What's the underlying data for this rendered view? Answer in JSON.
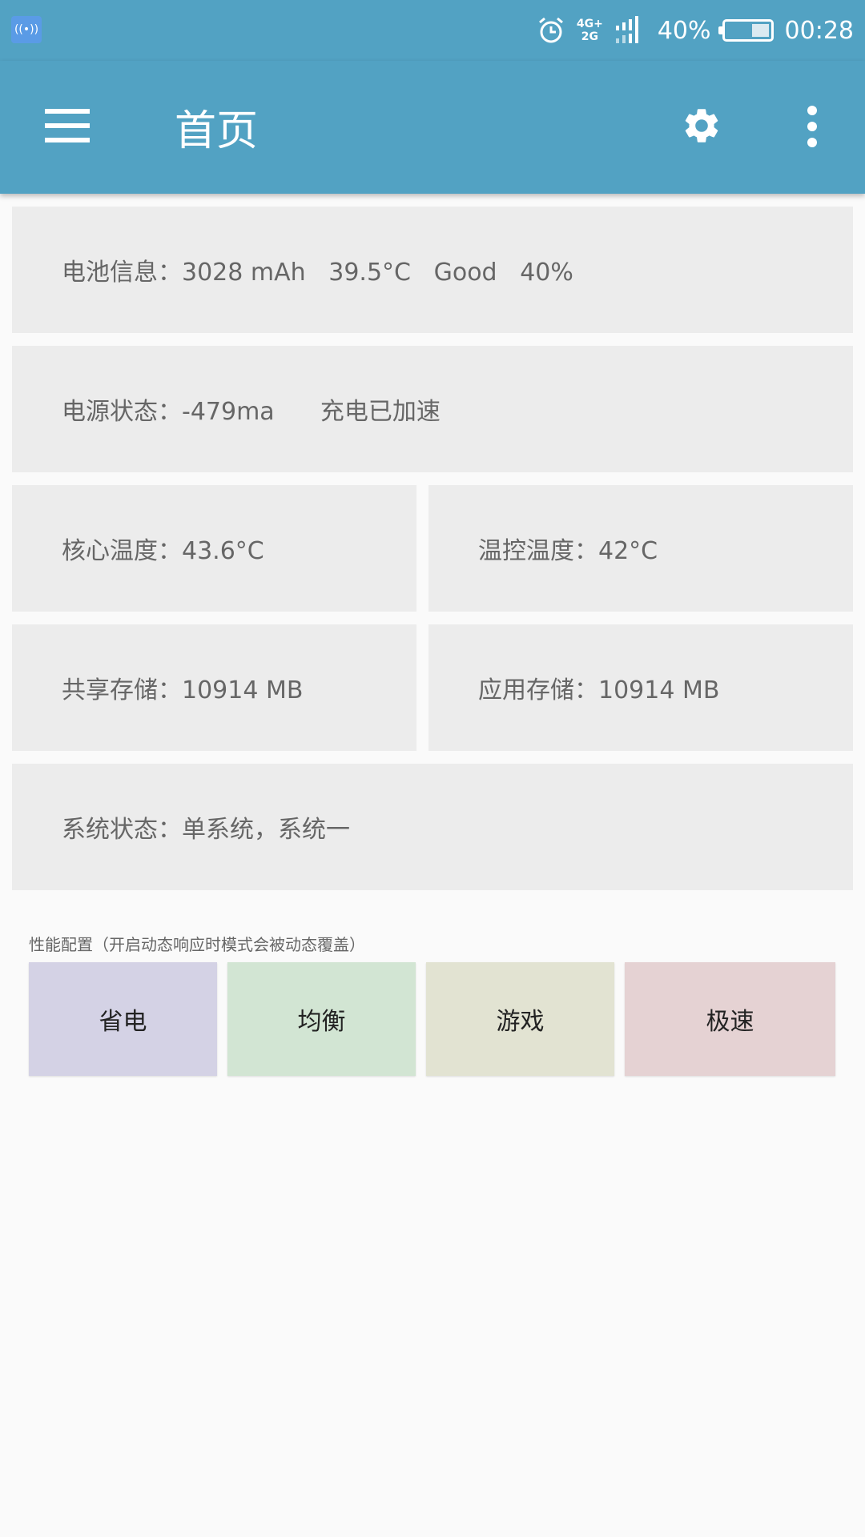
{
  "status_bar": {
    "network_top": "4G+",
    "network_bottom": "2G",
    "battery_percent": "40%",
    "time": "00:28",
    "battery_level": 0.4,
    "icons": [
      "hotspot-icon",
      "alarm-icon",
      "signal-icon",
      "battery-icon"
    ]
  },
  "app_bar": {
    "title": "首页",
    "icons": [
      "menu-icon",
      "settings-gear-icon",
      "more-vert-icon"
    ]
  },
  "cards": {
    "battery": "电池信息：3028 mAh   39.5°C   Good   40%",
    "power": "电源状态：-479ma      充电已加速",
    "core_temp": "核心温度：43.6°C",
    "thermal_temp": "温控温度：42°C",
    "shared_storage": "共享存储：10914 MB",
    "app_storage": "应用存储：10914 MB",
    "system": "系统状态：单系统，系统一"
  },
  "performance": {
    "label": "性能配置（开启动态响应时模式会被动态覆盖）",
    "modes": [
      {
        "label": "省电",
        "color": "#d4d2e5"
      },
      {
        "label": "均衡",
        "color": "#d2e5d3"
      },
      {
        "label": "游戏",
        "color": "#e2e3d2"
      },
      {
        "label": "极速",
        "color": "#e5d2d3"
      }
    ]
  }
}
